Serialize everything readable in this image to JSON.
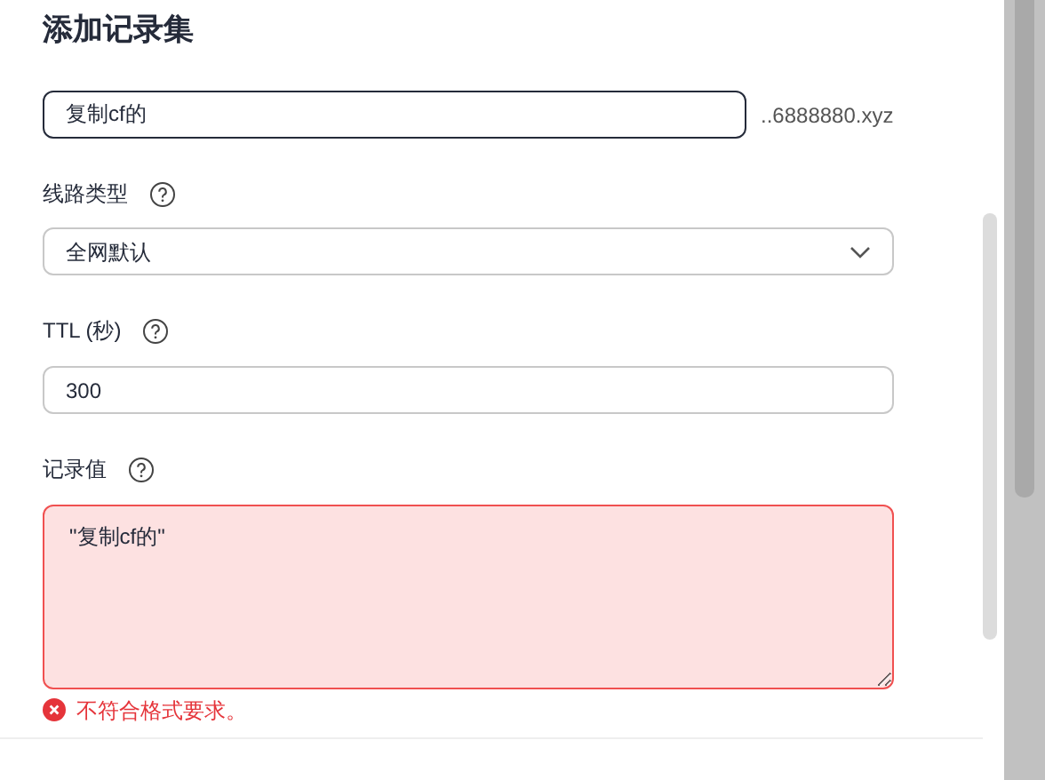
{
  "title": "添加记录集",
  "host": {
    "value": "复制cf的",
    "suffix": "..6888880.xyz",
    "focused": true
  },
  "line_type": {
    "label": "线路类型",
    "value": "全网默认"
  },
  "ttl": {
    "label": "TTL (秒)",
    "value": "300"
  },
  "record_value": {
    "label": "记录值",
    "value": "\"复制cf的\"",
    "invalid": true,
    "error": "不符合格式要求。"
  }
}
